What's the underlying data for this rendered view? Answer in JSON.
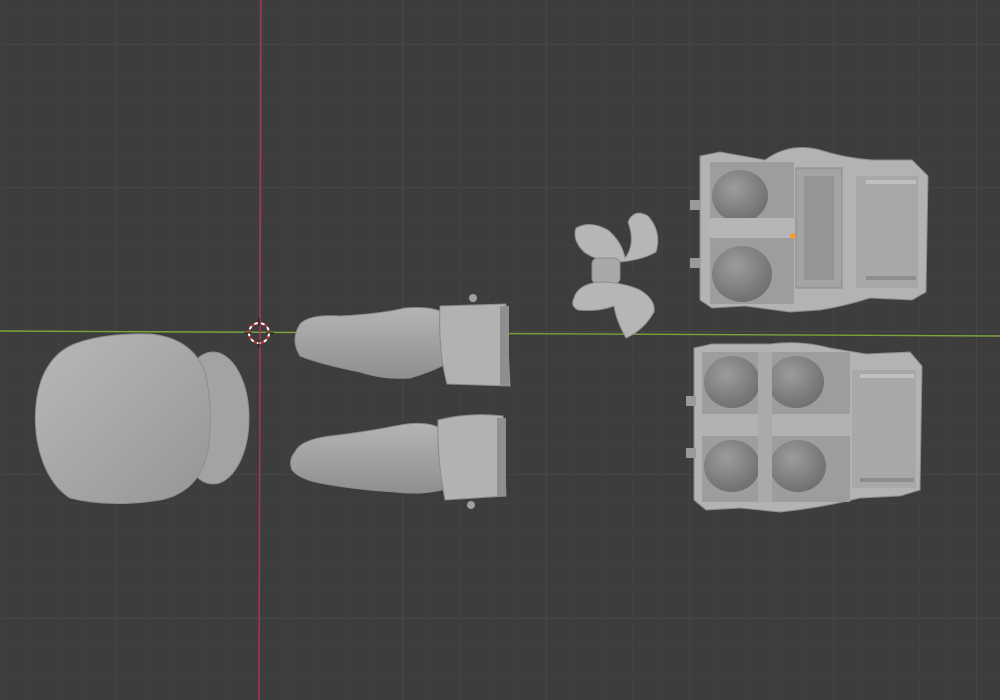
{
  "viewport": {
    "background": "#3d3d3d",
    "grid_minor_color": "#444444",
    "grid_major_color": "#4e4e4e",
    "x_axis_color": "#7aa33a",
    "y_axis_color": "#b0344a",
    "cursor_icon": "3d-cursor-icon",
    "origin_icon": "object-origin-icon",
    "origin_color": "#ff9a1a"
  },
  "objects": [
    {
      "name": "head"
    },
    {
      "name": "ear"
    },
    {
      "name": "arm-upper"
    },
    {
      "name": "arm-lower"
    },
    {
      "name": "bowtie"
    },
    {
      "name": "torso-top"
    },
    {
      "name": "torso-bottom"
    }
  ],
  "mesh_color": "#a9a9a9"
}
